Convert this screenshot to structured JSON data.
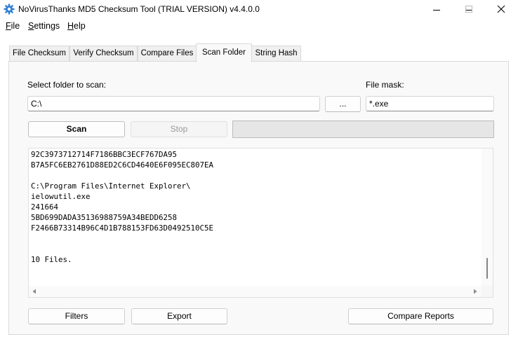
{
  "window": {
    "title": "NoVirusThanks MD5 Checksum Tool (TRIAL VERSION) v4.4.0.0",
    "icon": "gear-icon",
    "controls": [
      "minimize-icon",
      "maximize-icon",
      "close-icon"
    ]
  },
  "menu": {
    "file": {
      "key": "F",
      "rest": "ile"
    },
    "settings": {
      "key": "S",
      "rest": "ettings"
    },
    "help": {
      "key": "H",
      "rest": "elp"
    }
  },
  "tabs": [
    {
      "label": "File Checksum",
      "active": false
    },
    {
      "label": "Verify Checksum",
      "active": false
    },
    {
      "label": "Compare Files",
      "active": false
    },
    {
      "label": "Scan Folder",
      "active": true
    },
    {
      "label": "String Hash",
      "active": false
    }
  ],
  "scan_folder": {
    "folder_label": "Select folder to scan:",
    "folder_value": "C:\\",
    "browse_label": "...",
    "mask_label": "File mask:",
    "mask_value": "*.exe",
    "scan_label": "Scan",
    "stop_label": "Stop",
    "progress_fraction": 0.0
  },
  "output": {
    "lines": [
      "92C3973712714F7186BBC3ECF767DA95",
      "B7A5FC6EB2761D88ED2C6CD4640E6F095EC807EA",
      "",
      "C:\\Program Files\\Internet Explorer\\",
      "ielowutil.exe",
      "241664",
      "5BD699DADA35136988759A34BEDD6258",
      "F2466B73314B96C4D1B788153FD63D0492510C5E",
      "",
      "",
      "10 Files."
    ],
    "scroll_position": 0.95
  },
  "footer": {
    "filters_label": "Filters",
    "export_label": "Export",
    "compare_label": "Compare Reports"
  },
  "colors": {
    "accent": "#0078d4",
    "icon_blue": "#2f7fd6",
    "panel_bg": "#f9f9f9",
    "progress_fill": "#06b025"
  }
}
